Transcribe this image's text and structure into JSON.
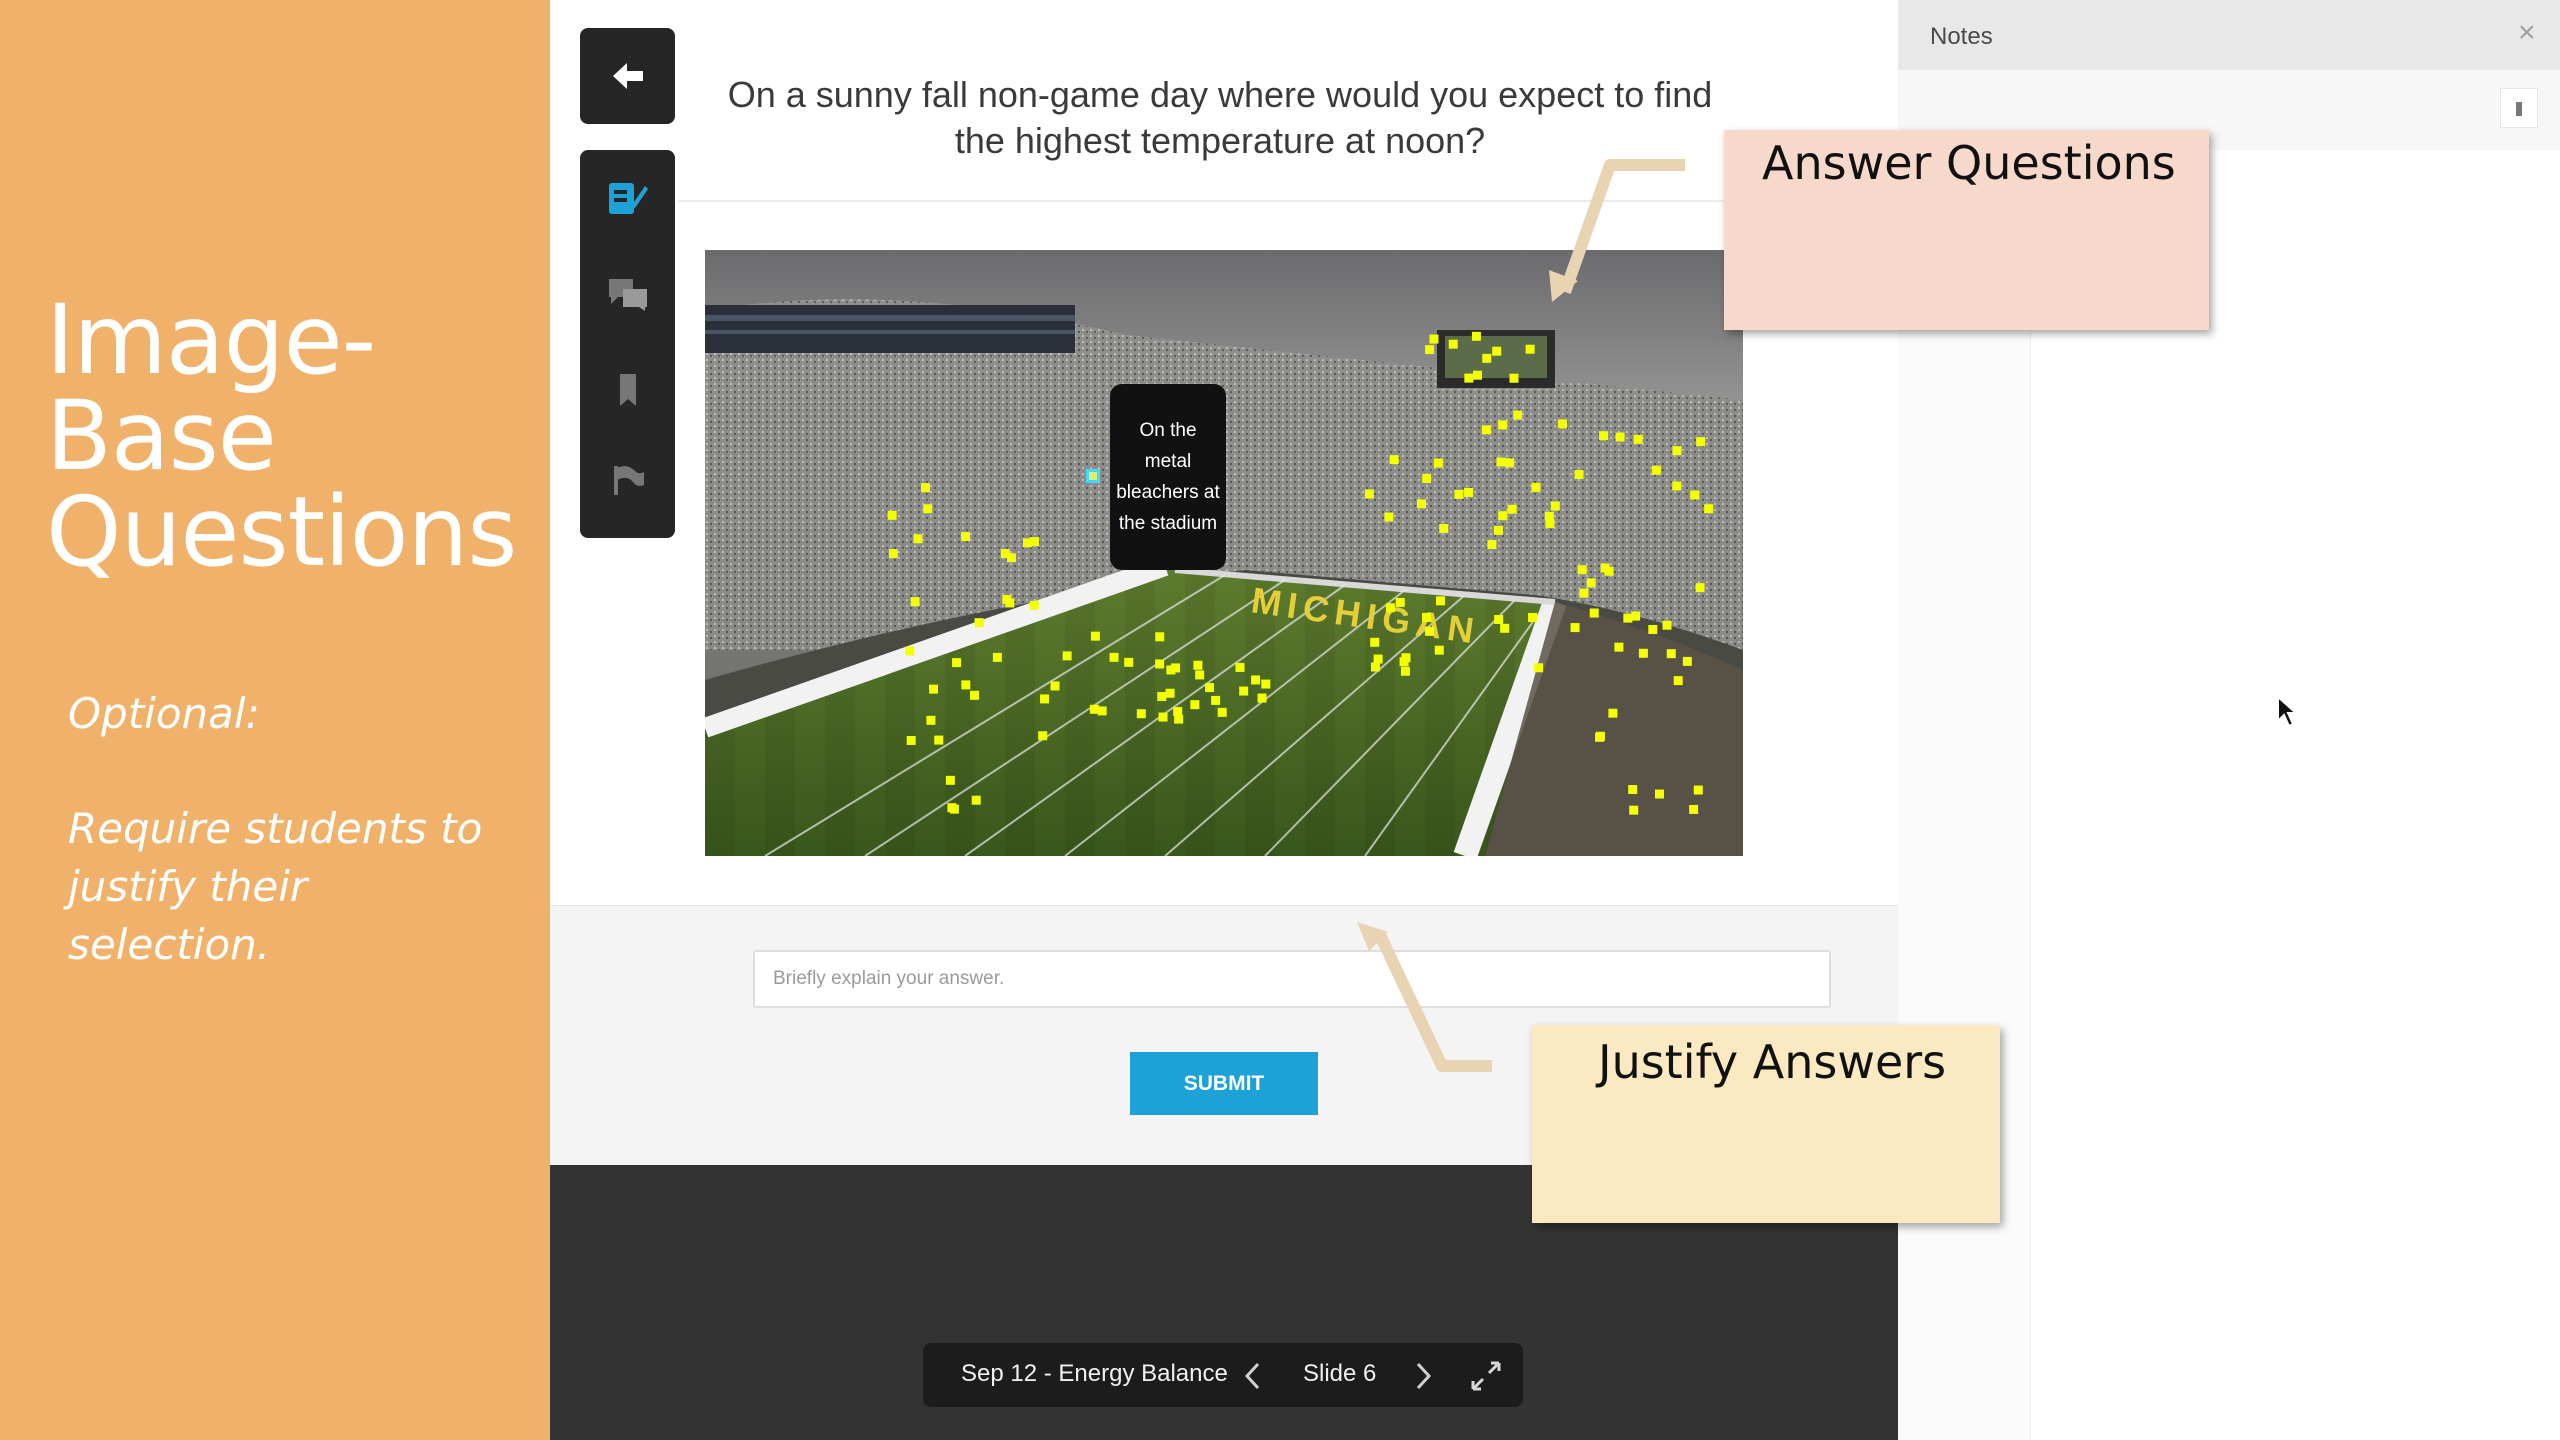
{
  "slide": {
    "title_lines": [
      "Image-",
      "Base",
      "Questions"
    ],
    "optional_label": "Optional:",
    "justify_note": "Require students to justify their selection."
  },
  "toolbar": {
    "back_icon": "arrow-left-icon",
    "tools": [
      "pencil-notes-icon",
      "chat-bubbles-icon",
      "bookmark-icon",
      "flag-icon"
    ]
  },
  "question": {
    "text": "On a sunny fall non-game day where would you expect to find the highest temperature at noon?",
    "image_caption_bubble": "On the metal bleachers at the stadium",
    "field_sign": "MICHIGAN"
  },
  "answer": {
    "placeholder": "Briefly explain your answer.",
    "submit_label": "SUBMIT"
  },
  "slide_nav": {
    "lesson": "Sep 12 - Energy Balance",
    "slide": "Slide 6",
    "prev_icon": "chevron-left-icon",
    "next_icon": "chevron-right-icon",
    "fullscreen_icon": "expand-icon"
  },
  "notes": {
    "title": "Notes",
    "close_icon": "close-icon"
  },
  "callouts": {
    "answer": "Answer Questions",
    "justify": "Justify Answers"
  },
  "colors": {
    "slide_background": "#f0b26a",
    "accent_blue": "#1da2d8",
    "toolbar_dark": "#262626",
    "marker_yellow": "#f4ff00",
    "answer_callout": "#f6d9cb",
    "justify_callout": "#fbeac1"
  }
}
